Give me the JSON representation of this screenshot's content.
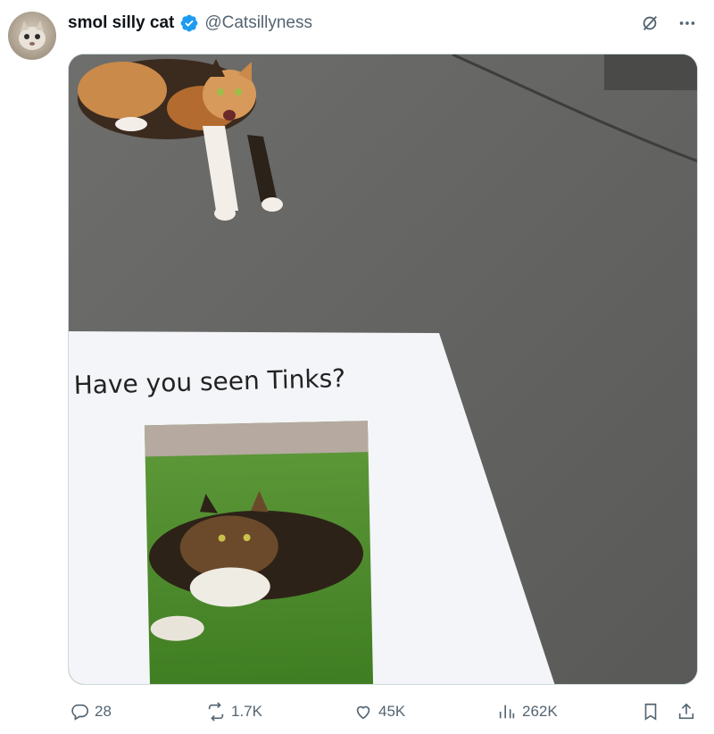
{
  "tweet": {
    "display_name": "smol silly cat",
    "handle": "@Catsillyness",
    "media": {
      "poster_text": "Have you seen Tinks?"
    }
  },
  "actions": {
    "replies": "28",
    "reposts": "1.7K",
    "likes": "45K",
    "views": "262K"
  },
  "icons": {
    "verified": "verified-badge-icon",
    "grok": "grok-icon",
    "more": "more-icon",
    "reply": "reply-icon",
    "repost": "repost-icon",
    "like": "heart-icon",
    "views": "views-chart-icon",
    "bookmark": "bookmark-icon",
    "share": "share-icon"
  },
  "colors": {
    "verified": "#1d9bf0",
    "secondary_text": "#536471",
    "primary_text": "#0f1419"
  }
}
